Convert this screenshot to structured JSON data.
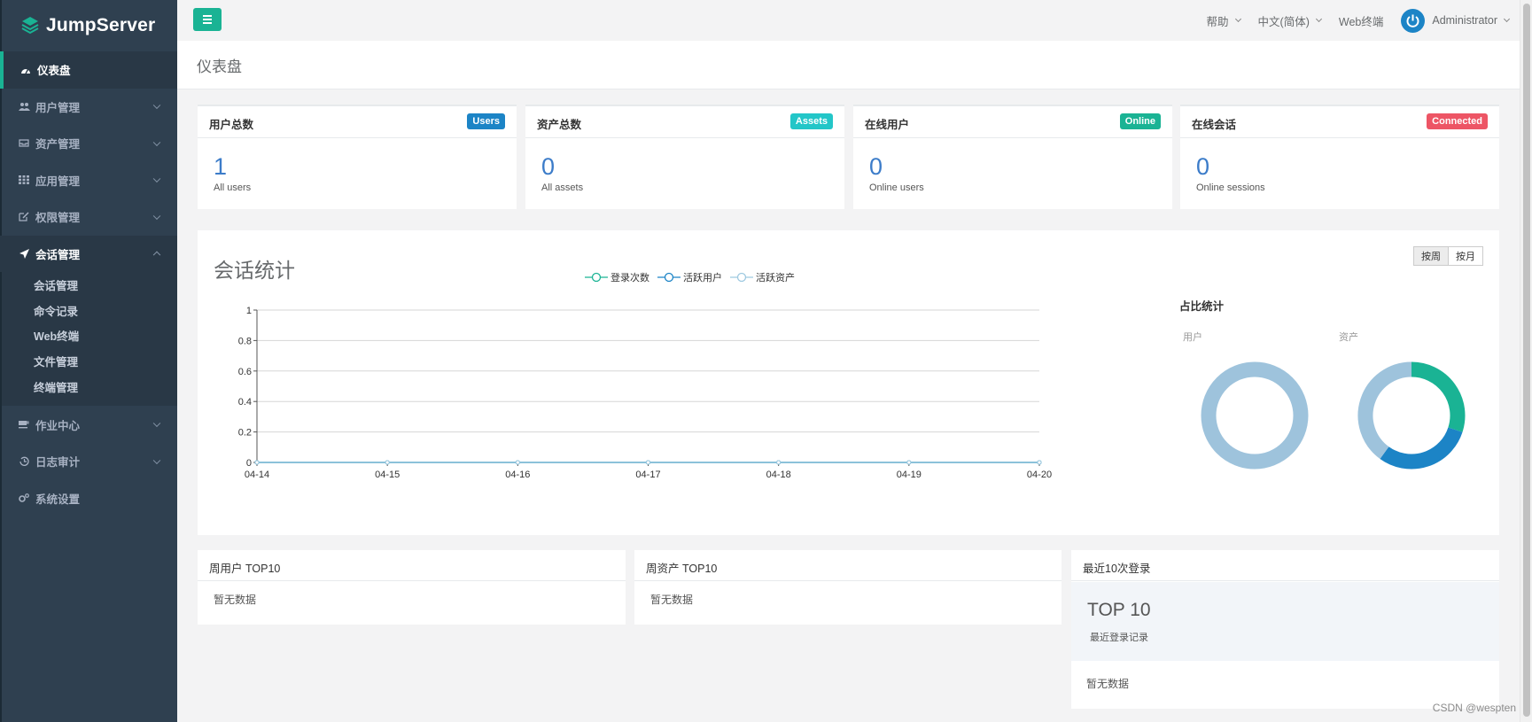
{
  "app": {
    "name": "JumpServer"
  },
  "sidebar": {
    "items": [
      {
        "label": "仪表盘",
        "icon": "dashboard-icon",
        "active": true
      },
      {
        "label": "用户管理",
        "icon": "users-icon"
      },
      {
        "label": "资产管理",
        "icon": "inbox-icon"
      },
      {
        "label": "应用管理",
        "icon": "grid-icon"
      },
      {
        "label": "权限管理",
        "icon": "edit-icon"
      },
      {
        "label": "会话管理",
        "icon": "rocket-icon",
        "open": true
      },
      {
        "label": "作业中心",
        "icon": "coffee-icon"
      },
      {
        "label": "日志审计",
        "icon": "history-icon"
      },
      {
        "label": "系统设置",
        "icon": "gears-icon"
      }
    ],
    "session_sub": [
      "会话管理",
      "命令记录",
      "Web终端",
      "文件管理",
      "终端管理"
    ]
  },
  "topbar": {
    "help": "帮助",
    "language": "中文(简体)",
    "web_terminal": "Web终端",
    "user": "Administrator"
  },
  "page": {
    "title": "仪表盘"
  },
  "stats": [
    {
      "title": "用户总数",
      "badge": "Users",
      "badge_color": "#1c84c6",
      "value": "1",
      "sub": "All users"
    },
    {
      "title": "资产总数",
      "badge": "Assets",
      "badge_color": "#23c6c8",
      "value": "0",
      "sub": "All assets"
    },
    {
      "title": "在线用户",
      "badge": "Online",
      "badge_color": "#1ab394",
      "value": "0",
      "sub": "Online users"
    },
    {
      "title": "在线会话",
      "badge": "Connected",
      "badge_color": "#ed5565",
      "value": "0",
      "sub": "Online sessions"
    }
  ],
  "session_panel": {
    "title": "会话统计",
    "buttons": [
      "按周",
      "按月"
    ],
    "ratio_title": "占比统计",
    "ratio_labels": [
      "用户",
      "资产"
    ]
  },
  "chart_data": {
    "type": "line",
    "categories": [
      "04-14",
      "04-15",
      "04-16",
      "04-17",
      "04-18",
      "04-19",
      "04-20"
    ],
    "series": [
      {
        "name": "登录次数",
        "color": "#1ab394",
        "values": [
          0,
          0,
          0,
          0,
          0,
          0,
          0
        ]
      },
      {
        "name": "活跃用户",
        "color": "#1c84c6",
        "values": [
          0,
          0,
          0,
          0,
          0,
          0,
          0
        ]
      },
      {
        "name": "活跃资产",
        "color": "#9ec9e0",
        "values": [
          0,
          0,
          0,
          0,
          0,
          0,
          0
        ]
      }
    ],
    "ylim": [
      0,
      1
    ],
    "yticks": [
      "0",
      "0.2",
      "0.4",
      "0.6",
      "0.8",
      "1"
    ],
    "grid": true,
    "legend": "top-center"
  },
  "donut_data": {
    "user": {
      "colors": [
        "#9ec3dc"
      ],
      "values": [
        1
      ]
    },
    "asset": {
      "colors": [
        "#1ab394",
        "#1c84c6",
        "#9ec3dc"
      ],
      "values": [
        0.3,
        0.3,
        0.4
      ]
    }
  },
  "bottom": {
    "week_users": {
      "title": "周用户 TOP10",
      "empty": "暂无数据"
    },
    "week_assets": {
      "title": "周资产 TOP10",
      "empty": "暂无数据"
    },
    "recent_logins": {
      "title": "最近10次登录",
      "top_label": "TOP 10",
      "top_sub": "最近登录记录",
      "empty": "暂无数据"
    }
  },
  "watermark": "CSDN @wespten"
}
